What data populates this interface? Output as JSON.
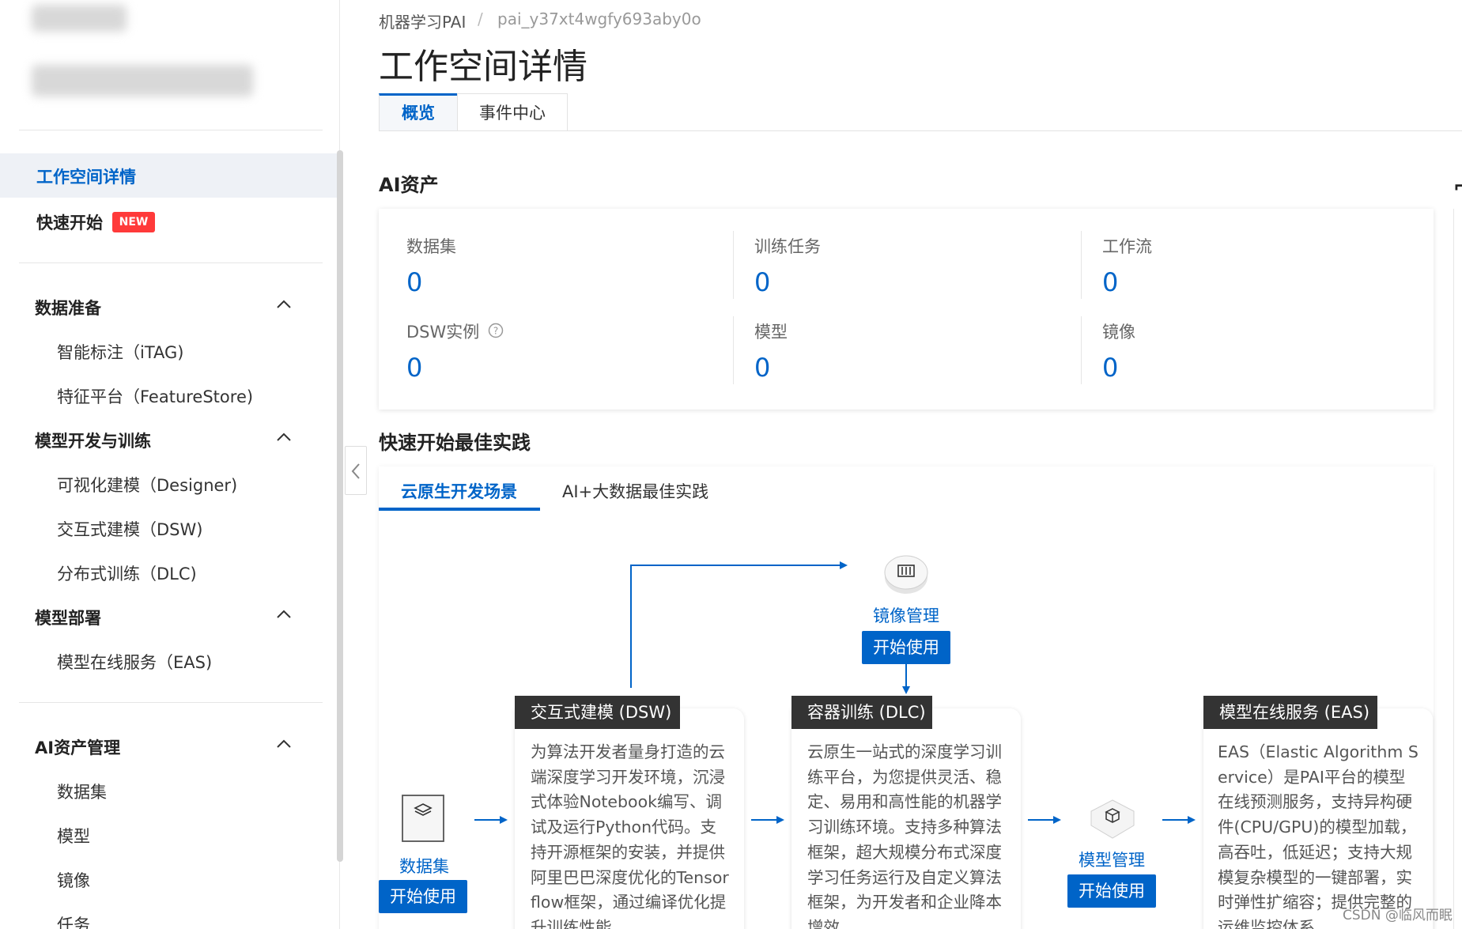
{
  "breadcrumb": {
    "root": "机器学习PAI",
    "separator": "/",
    "workspace": "pai_y37xt4wgfy693aby0o"
  },
  "page_title": "工作空间详情",
  "tabs": {
    "overview": "概览",
    "events": "事件中心"
  },
  "sidebar": {
    "active_item": "工作空间详情",
    "quick_start": "快速开始",
    "new_badge": "NEW",
    "groups": [
      {
        "title": "数据准备",
        "items": [
          "智能标注（iTAG)",
          "特征平台（FeatureStore)"
        ]
      },
      {
        "title": "模型开发与训练",
        "items": [
          "可视化建模（Designer)",
          "交互式建模（DSW)",
          "分布式训练（DLC)"
        ]
      },
      {
        "title": "模型部署",
        "items": [
          "模型在线服务（EAS)"
        ]
      },
      {
        "title": "AI资产管理",
        "items": [
          "数据集",
          "模型",
          "镜像",
          "任务"
        ]
      }
    ]
  },
  "ai_assets": {
    "title": "AI资产",
    "items": [
      {
        "label": "数据集",
        "value": "0"
      },
      {
        "label": "训练任务",
        "value": "0"
      },
      {
        "label": "工作流",
        "value": "0"
      },
      {
        "label": "DSW实例",
        "value": "0"
      },
      {
        "label": "模型",
        "value": "0"
      },
      {
        "label": "镜像",
        "value": "0"
      }
    ]
  },
  "best_practice": {
    "title": "快速开始最佳实践",
    "tabs": [
      "云原生开发场景",
      "AI+大数据最佳实践"
    ],
    "start_label": "开始使用",
    "nodes": {
      "dataset": "数据集",
      "image_mgmt": "镜像管理",
      "model_mgmt": "模型管理"
    },
    "stages": [
      {
        "title": "交互式建模 (DSW)",
        "desc": "为算法开发者量身打造的云端深度学习开发环境，沉浸式体验Notebook编写、调试及运行Python代码。支持开源框架的安装，并提供阿里巴巴深度优化的Tensorflow框架，通过编译优化提升训练性能。"
      },
      {
        "title": "容器训练 (DLC)",
        "desc": "云原生一站式的深度学习训练平台，为您提供灵活、稳定、易用和高性能的机器学习训练环境。支持多种算法框架，超大规模分布式深度学习任务运行及自定义算法框架，为开发者和企业降本增效。"
      },
      {
        "title": "模型在线服务 (EAS)",
        "desc": "EAS（Elastic Algorithm Service）是PAI平台的模型在线预测服务，支持异构硬件(CPU/GPU)的模型加载，高吞吐，低延迟；支持大规模复杂模型的一键部署，实时弹性扩缩容；提供完整的运维监控体系。"
      }
    ]
  },
  "watermark": "CSDN @临风而眠",
  "colors": {
    "accent": "#0064c8",
    "badge": "#ff3a3a",
    "stage_header": "#333333"
  }
}
